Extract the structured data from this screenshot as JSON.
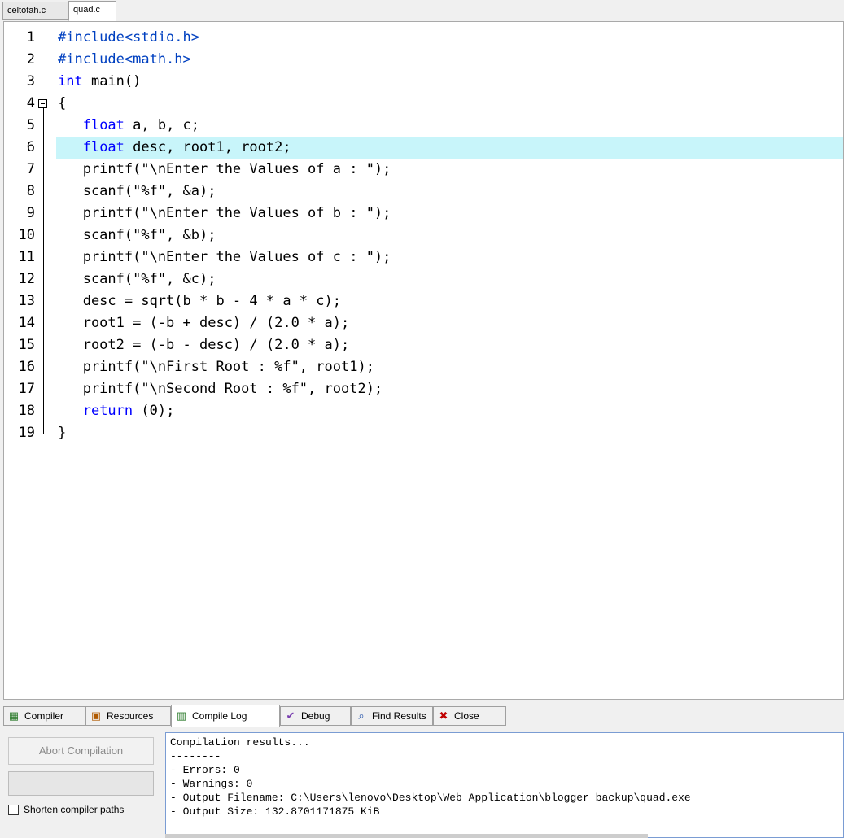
{
  "editor_tabs": [
    {
      "label": "celtofah.c",
      "active": false
    },
    {
      "label": "quad.c",
      "active": true
    }
  ],
  "editor": {
    "highlighted_line": 6,
    "lines": [
      {
        "n": "1",
        "segments": [
          {
            "t": "#include<stdio.h>",
            "c": "pp"
          }
        ]
      },
      {
        "n": "2",
        "segments": [
          {
            "t": "#include<math.h>",
            "c": "pp"
          }
        ]
      },
      {
        "n": "3",
        "segments": [
          {
            "t": "int",
            "c": "kw"
          },
          {
            "t": " main()",
            "c": ""
          }
        ]
      },
      {
        "n": "4",
        "segments": [
          {
            "t": "{",
            "c": ""
          }
        ]
      },
      {
        "n": "5",
        "segments": [
          {
            "t": "   ",
            "c": ""
          },
          {
            "t": "float",
            "c": "kw"
          },
          {
            "t": " a, b, c;",
            "c": ""
          }
        ]
      },
      {
        "n": "6",
        "segments": [
          {
            "t": "   ",
            "c": ""
          },
          {
            "t": "float",
            "c": "kw"
          },
          {
            "t": " desc, root1, root2;",
            "c": ""
          }
        ]
      },
      {
        "n": "7",
        "segments": [
          {
            "t": "   printf(\"\\nEnter the Values of a : \");",
            "c": ""
          }
        ]
      },
      {
        "n": "8",
        "segments": [
          {
            "t": "   scanf(\"%f\", &a);",
            "c": ""
          }
        ]
      },
      {
        "n": "9",
        "segments": [
          {
            "t": "   printf(\"\\nEnter the Values of b : \");",
            "c": ""
          }
        ]
      },
      {
        "n": "10",
        "segments": [
          {
            "t": "   scanf(\"%f\", &b);",
            "c": ""
          }
        ]
      },
      {
        "n": "11",
        "segments": [
          {
            "t": "   printf(\"\\nEnter the Values of c : \");",
            "c": ""
          }
        ]
      },
      {
        "n": "12",
        "segments": [
          {
            "t": "   scanf(\"%f\", &c);",
            "c": ""
          }
        ]
      },
      {
        "n": "13",
        "segments": [
          {
            "t": "   desc = sqrt(b * b - 4 * a * c);",
            "c": ""
          }
        ]
      },
      {
        "n": "14",
        "segments": [
          {
            "t": "   root1 = (-b + desc) / (2.0 * a);",
            "c": ""
          }
        ]
      },
      {
        "n": "15",
        "segments": [
          {
            "t": "   root2 = (-b - desc) / (2.0 * a);",
            "c": ""
          }
        ]
      },
      {
        "n": "16",
        "segments": [
          {
            "t": "   printf(\"\\nFirst Root : %f\", root1);",
            "c": ""
          }
        ]
      },
      {
        "n": "17",
        "segments": [
          {
            "t": "   printf(\"\\nSecond Root : %f\", root2);",
            "c": ""
          }
        ]
      },
      {
        "n": "18",
        "segments": [
          {
            "t": "   ",
            "c": ""
          },
          {
            "t": "return",
            "c": "kw"
          },
          {
            "t": " (0);",
            "c": ""
          }
        ]
      },
      {
        "n": "19",
        "segments": [
          {
            "t": "}",
            "c": ""
          }
        ]
      }
    ]
  },
  "bottom_tabs": [
    {
      "label": "Compiler",
      "icon": "grid-icon",
      "glyph": "▦",
      "color": "#2a7a2a",
      "active": false
    },
    {
      "label": "Resources",
      "icon": "resources-icon",
      "glyph": "▣",
      "color": "#b05a00",
      "active": false
    },
    {
      "label": "Compile Log",
      "icon": "bar-chart-icon",
      "glyph": "▥",
      "color": "#2a7a2a",
      "active": true
    },
    {
      "label": "Debug",
      "icon": "checkmark-icon",
      "glyph": "✔",
      "color": "#7a3fb0",
      "active": false
    },
    {
      "label": "Find Results",
      "icon": "find-icon",
      "glyph": "⌕",
      "color": "#1f4fa8",
      "active": false
    },
    {
      "label": "Close",
      "icon": "close-icon",
      "glyph": "✖",
      "color": "#c00000",
      "active": false
    }
  ],
  "panel": {
    "abort_label": "Abort Compilation",
    "shorten_label": "Shorten compiler paths",
    "shorten_checked": false
  },
  "log_lines": [
    "Compilation results...",
    "--------",
    "- Errors: 0",
    "- Warnings: 0",
    "- Output Filename: C:\\Users\\lenovo\\Desktop\\Web Application\\blogger backup\\quad.exe",
    "- Output Size: 132.8701171875 KiB"
  ]
}
